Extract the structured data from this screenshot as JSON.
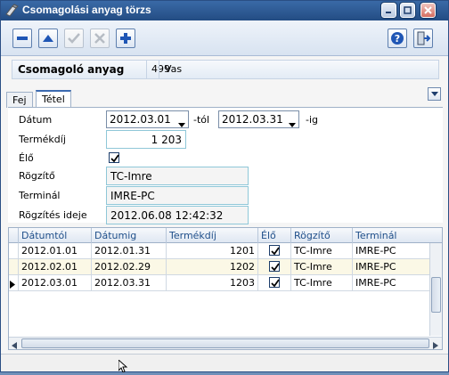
{
  "window": {
    "title": "Csomagolási anyag törzs"
  },
  "toolbar": {
    "buttons": [
      {
        "icon": "minus-icon"
      },
      {
        "icon": "triangle-up-icon"
      },
      {
        "icon": "check-icon"
      },
      {
        "icon": "x-icon"
      },
      {
        "icon": "plus-icon"
      },
      {
        "icon": "help-icon"
      },
      {
        "icon": "exit-door-icon"
      }
    ]
  },
  "header": {
    "label": "Csomagoló anyag",
    "code": "499",
    "name": "Vas"
  },
  "tabs": [
    {
      "label": "Fej"
    },
    {
      "label": "Tétel"
    }
  ],
  "form": {
    "datum_label": "Dátum",
    "date_from": "2012.03.01",
    "tol_label": "-tól",
    "date_to": "2012.03.31",
    "ig_label": "-ig",
    "termekdij_label": "Termékdíj",
    "termekdij_value": "1 203",
    "elo_label": "Élő",
    "elo_checked": true,
    "rogzito_label": "Rögzítő",
    "rogzito_value": "TC-Imre",
    "terminal_label": "Terminál",
    "terminal_value": "IMRE-PC",
    "rogzites_label": "Rögzítés ideje",
    "rogzites_value": "2012.06.08 12:42:32"
  },
  "grid": {
    "columns": [
      "Dátumtól",
      "Dátumig",
      "Termékdíj",
      "Élő",
      "Rögzítő",
      "Terminál"
    ],
    "rows": [
      {
        "from": "2012.01.01",
        "to": "2012.01.31",
        "fee": "1201",
        "alive": true,
        "user": "TC-Imre",
        "terminal": "IMRE-PC"
      },
      {
        "from": "2012.02.01",
        "to": "2012.02.29",
        "fee": "1202",
        "alive": true,
        "user": "TC-Imre",
        "terminal": "IMRE-PC"
      },
      {
        "from": "2012.03.01",
        "to": "2012.03.31",
        "fee": "1203",
        "alive": true,
        "user": "TC-Imre",
        "terminal": "IMRE-PC"
      }
    ],
    "current_row": 2
  }
}
